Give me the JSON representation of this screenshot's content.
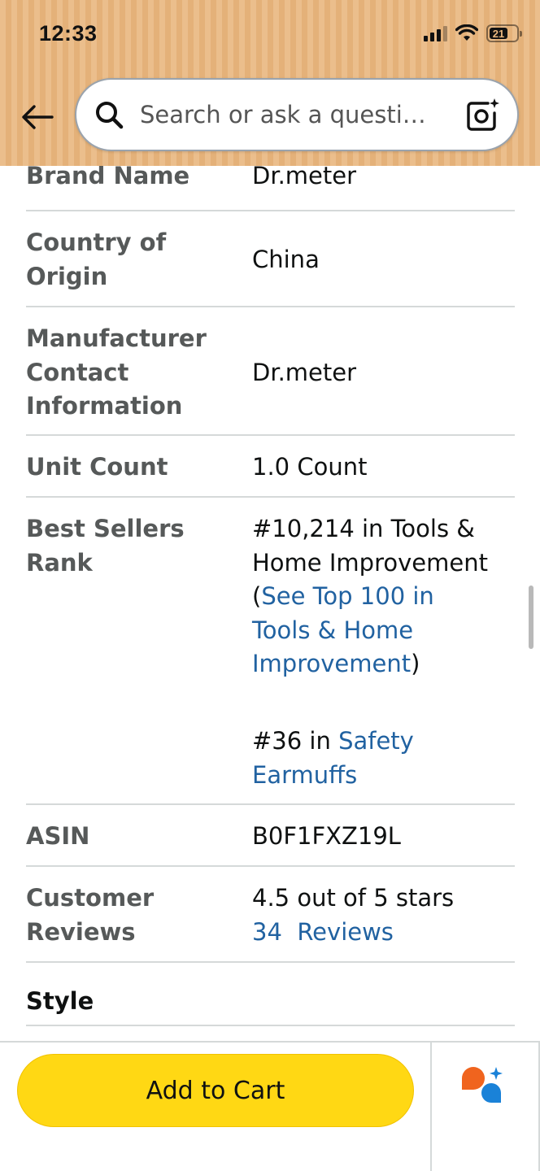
{
  "status_bar": {
    "time": "12:33",
    "battery_level": "21"
  },
  "header": {
    "back_icon": "arrow-left-icon",
    "search_icon": "magnifier-icon",
    "search_placeholder": "Search or ask a questi…",
    "camera_icon": "camera-sparkle-icon",
    "background_color": "#e9b77f"
  },
  "specs": [
    {
      "label": "Brand Name",
      "value": "Dr.meter"
    },
    {
      "label": "Country of Origin",
      "value": "China"
    },
    {
      "label": "Manufacturer Contact Information",
      "value": "Dr.meter"
    },
    {
      "label": "Unit Count",
      "value": "1.0 Count"
    },
    {
      "label": "Best Sellers Rank",
      "rank1_prefix": "#10,214 in Tools & Home Improvement (",
      "rank1_link": "See Top 100 in Tools & Home Improvement",
      "rank1_suffix": ")",
      "rank2_prefix": "#36 in ",
      "rank2_link": "Safety Earmuffs"
    },
    {
      "label": "ASIN",
      "value": "B0F1FXZ19L"
    },
    {
      "label": "Customer Reviews",
      "value": "4.5 out of 5 stars",
      "reviews_link": "34  Reviews"
    }
  ],
  "style_section": {
    "label": "Style"
  },
  "bottom_bar": {
    "add_to_cart_label": "Add to Cart",
    "button_color": "#ffd814",
    "assistant_icon": "rufus-chat-icon"
  },
  "colors": {
    "link": "#2162a1",
    "label": "#565959",
    "divider": "#d5d9d9"
  }
}
